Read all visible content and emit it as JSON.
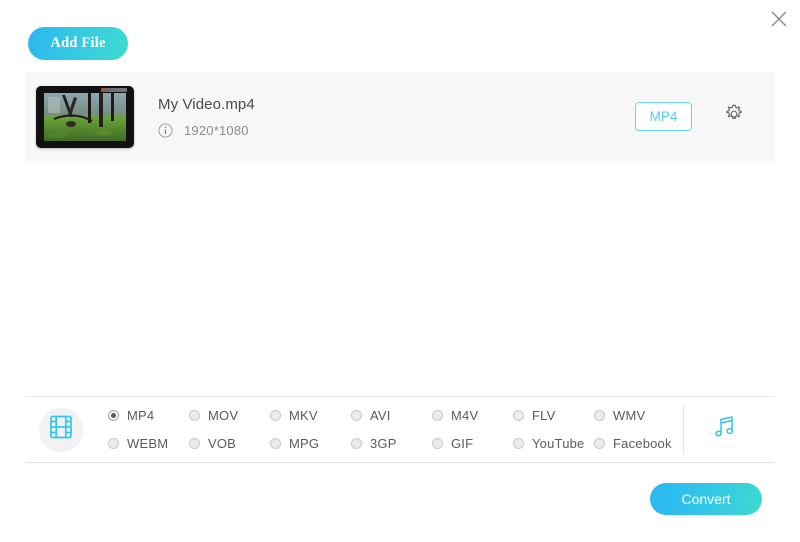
{
  "window": {
    "close_label": "✕"
  },
  "toolbar": {
    "add_file_label": "Add File"
  },
  "file_list": {
    "items": [
      {
        "name": "My Video.mp4",
        "resolution": "1920*1080",
        "output_format": "MP4",
        "info_icon": "info-circle-icon",
        "settings_icon": "gear-icon",
        "thumbnail": "forest-video-thumbnail"
      }
    ]
  },
  "format_panel": {
    "media_type_icon": "film-strip-icon",
    "audio_icon": "music-note-icon",
    "selected_format": "MP4",
    "formats": [
      "MP4",
      "MOV",
      "MKV",
      "AVI",
      "M4V",
      "FLV",
      "WMV",
      "WEBM",
      "VOB",
      "MPG",
      "3GP",
      "GIF",
      "YouTube",
      "Facebook"
    ]
  },
  "actions": {
    "convert_label": "Convert"
  },
  "colors": {
    "accent_cyan": "#3fcde8",
    "gradient_start": "#2ab7f2",
    "gradient_end": "#3ed9cf",
    "row_background": "#f7f7f7",
    "text_primary": "#4a4a4a",
    "text_secondary": "#8d8d8d"
  }
}
